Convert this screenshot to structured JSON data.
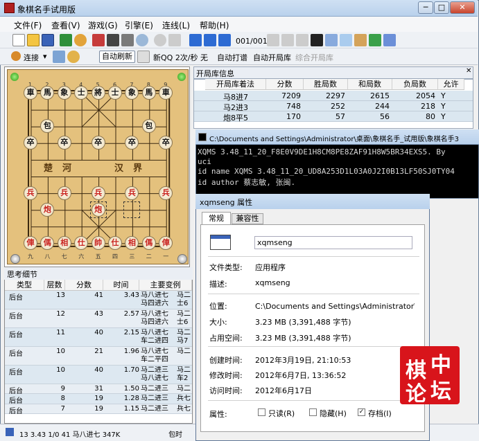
{
  "app": {
    "title": "象棋名手试用版"
  },
  "menu": [
    "文件(F)",
    "查看(V)",
    "游戏(G)",
    "引擎(E)",
    "连线(L)",
    "帮助(H)"
  ],
  "toolbar1": {
    "move_counter": "001/001"
  },
  "toolbar2": {
    "connect": "连接",
    "auto_refresh": "自动刷新",
    "net_speed": "新QQ 2次/秒 无",
    "auto_play": "自动打谱",
    "auto_book": "自动开局库",
    "combine_book": "综合开局库"
  },
  "board": {
    "top_numbers": [
      "1",
      "2",
      "3",
      "4",
      "5",
      "6",
      "7",
      "8",
      "9"
    ],
    "bottom_numbers": [
      "九",
      "八",
      "七",
      "六",
      "五",
      "四",
      "三",
      "二",
      "一"
    ],
    "river_left": "楚河",
    "river_right": "汉界",
    "pieces": [
      {
        "t": "車",
        "c": "black",
        "col": 0,
        "row": 0
      },
      {
        "t": "馬",
        "c": "black",
        "col": 1,
        "row": 0
      },
      {
        "t": "象",
        "c": "black",
        "col": 2,
        "row": 0
      },
      {
        "t": "士",
        "c": "black",
        "col": 3,
        "row": 0
      },
      {
        "t": "將",
        "c": "black",
        "col": 4,
        "row": 0
      },
      {
        "t": "士",
        "c": "black",
        "col": 5,
        "row": 0
      },
      {
        "t": "象",
        "c": "black",
        "col": 6,
        "row": 0
      },
      {
        "t": "馬",
        "c": "black",
        "col": 7,
        "row": 0
      },
      {
        "t": "車",
        "c": "black",
        "col": 8,
        "row": 0
      },
      {
        "t": "包",
        "c": "black",
        "col": 1,
        "row": 2
      },
      {
        "t": "包",
        "c": "black",
        "col": 7,
        "row": 2
      },
      {
        "t": "卒",
        "c": "black",
        "col": 0,
        "row": 3
      },
      {
        "t": "卒",
        "c": "black",
        "col": 2,
        "row": 3
      },
      {
        "t": "卒",
        "c": "black",
        "col": 4,
        "row": 3
      },
      {
        "t": "卒",
        "c": "black",
        "col": 6,
        "row": 3
      },
      {
        "t": "卒",
        "c": "black",
        "col": 8,
        "row": 3
      },
      {
        "t": "兵",
        "c": "red",
        "col": 0,
        "row": 6
      },
      {
        "t": "兵",
        "c": "red",
        "col": 2,
        "row": 6
      },
      {
        "t": "兵",
        "c": "red",
        "col": 4,
        "row": 6
      },
      {
        "t": "兵",
        "c": "red",
        "col": 6,
        "row": 6
      },
      {
        "t": "兵",
        "c": "red",
        "col": 8,
        "row": 6
      },
      {
        "t": "炮",
        "c": "red",
        "col": 1,
        "row": 7
      },
      {
        "t": "炮",
        "c": "red",
        "col": 4,
        "row": 7
      },
      {
        "t": "俥",
        "c": "red",
        "col": 0,
        "row": 9
      },
      {
        "t": "傌",
        "c": "red",
        "col": 1,
        "row": 9
      },
      {
        "t": "相",
        "c": "red",
        "col": 2,
        "row": 9
      },
      {
        "t": "仕",
        "c": "red",
        "col": 3,
        "row": 9
      },
      {
        "t": "帥",
        "c": "red",
        "col": 4,
        "row": 9
      },
      {
        "t": "仕",
        "c": "red",
        "col": 5,
        "row": 9
      },
      {
        "t": "相",
        "c": "red",
        "col": 6,
        "row": 9
      },
      {
        "t": "傌",
        "c": "red",
        "col": 7,
        "row": 9
      },
      {
        "t": "俥",
        "c": "red",
        "col": 8,
        "row": 9
      }
    ]
  },
  "analysis": {
    "title": "思考细节",
    "headers": [
      "类型",
      "层数",
      "分数",
      "时间",
      "主要变例"
    ],
    "rows": [
      [
        "后台",
        "13",
        "41",
        "3.43",
        "马八进七 马四进六",
        "马二 士6"
      ],
      [
        "后台",
        "12",
        "43",
        "2.57",
        "马八进七 马四进六",
        "马二 士6"
      ],
      [
        "后台",
        "11",
        "40",
        "2.15",
        "马八进七 车二进四",
        "马二 马7"
      ],
      [
        "后台",
        "10",
        "21",
        "1.96",
        "马八进七 车二平四",
        "马二"
      ],
      [
        "后台",
        "10",
        "40",
        "1.70",
        "马二进三 马八进七",
        "马二 车2"
      ],
      [
        "后台",
        "9",
        "31",
        "1.50",
        "马二进三",
        "马二"
      ],
      [
        "后台",
        "8",
        "19",
        "1.28",
        "马二进三",
        "兵七"
      ],
      [
        "后台",
        "7",
        "19",
        "1.15",
        "马二进三",
        "兵七"
      ]
    ]
  },
  "status": {
    "left": "13 3.43 1/0 41 马八进七 347K",
    "right": "包时"
  },
  "opening_book": {
    "title": "开局库信息",
    "headers": [
      "开局库着法",
      "分数",
      "胜局数",
      "和局数",
      "负局数",
      "允许"
    ],
    "rows": [
      [
        "马8进7",
        "7209",
        "2297",
        "2615",
        "2054",
        "Y"
      ],
      [
        "马2进3",
        "748",
        "252",
        "244",
        "218",
        "Y"
      ],
      [
        "炮8平5",
        "170",
        "57",
        "56",
        "80",
        "Y"
      ]
    ]
  },
  "console": {
    "title": "C:\\Documents and Settings\\Administrator\\桌面\\象棋名手_试用版\\象棋名手3",
    "lines": [
      "XQMS 3.48_11_20_F8E0V9DE1H8CM8PE8ZAF91H8W5BR34EXS5. By",
      "uci",
      "id name XQMS 3.48_11_20_UD8A253D1L03A0J2I0B13LF50SJ0TY04",
      "id author 蔡志敏, 张闽."
    ]
  },
  "dialog": {
    "title": "xqmseng 属性",
    "tabs": [
      "常规",
      "兼容性"
    ],
    "filename": "xqmseng",
    "fields": [
      {
        "label": "文件类型:",
        "value": "应用程序"
      },
      {
        "label": "描述:",
        "value": "xqmseng"
      },
      {
        "label": "位置:",
        "value": "C:\\Documents and Settings\\Administrator\\桌"
      },
      {
        "label": "大小:",
        "value": "3.23 MB (3,391,488 字节)"
      },
      {
        "label": "占用空间:",
        "value": "3.23 MB (3,391,488 字节)"
      },
      {
        "label": "创建时间:",
        "value": "2012年3月19日, 21:10:53"
      },
      {
        "label": "修改时间:",
        "value": "2012年6月7日, 13:36:52"
      },
      {
        "label": "访问时间:",
        "value": "2012年6月17日"
      }
    ],
    "attr_label": "属性:",
    "checkboxes": [
      {
        "label": "只读(R)",
        "checked": false
      },
      {
        "label": "隐藏(H)",
        "checked": false
      },
      {
        "label": "存档(I)",
        "checked": true
      }
    ]
  },
  "watermark": [
    "棋",
    "中",
    "论",
    "坛"
  ]
}
